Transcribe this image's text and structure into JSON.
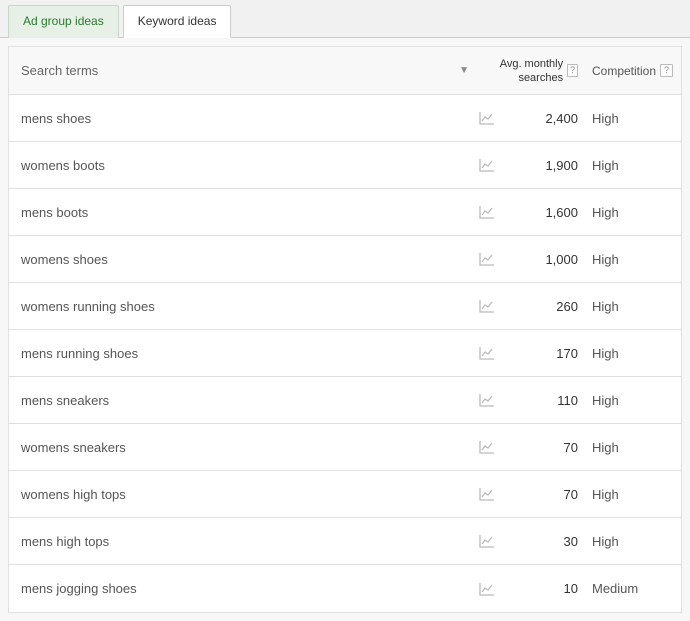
{
  "tabs": {
    "inactive": "Ad group ideas",
    "active": "Keyword ideas"
  },
  "headers": {
    "search_terms": "Search terms",
    "avg_monthly": "Avg. monthly searches",
    "competition": "Competition",
    "help": "?"
  },
  "rows": [
    {
      "term": "mens shoes",
      "searches": "2,400",
      "competition": "High"
    },
    {
      "term": "womens boots",
      "searches": "1,900",
      "competition": "High"
    },
    {
      "term": "mens boots",
      "searches": "1,600",
      "competition": "High"
    },
    {
      "term": "womens shoes",
      "searches": "1,000",
      "competition": "High"
    },
    {
      "term": "womens running shoes",
      "searches": "260",
      "competition": "High"
    },
    {
      "term": "mens running shoes",
      "searches": "170",
      "competition": "High"
    },
    {
      "term": "mens sneakers",
      "searches": "110",
      "competition": "High"
    },
    {
      "term": "womens sneakers",
      "searches": "70",
      "competition": "High"
    },
    {
      "term": "womens high tops",
      "searches": "70",
      "competition": "High"
    },
    {
      "term": "mens high tops",
      "searches": "30",
      "competition": "High"
    },
    {
      "term": "mens jogging shoes",
      "searches": "10",
      "competition": "Medium"
    }
  ]
}
